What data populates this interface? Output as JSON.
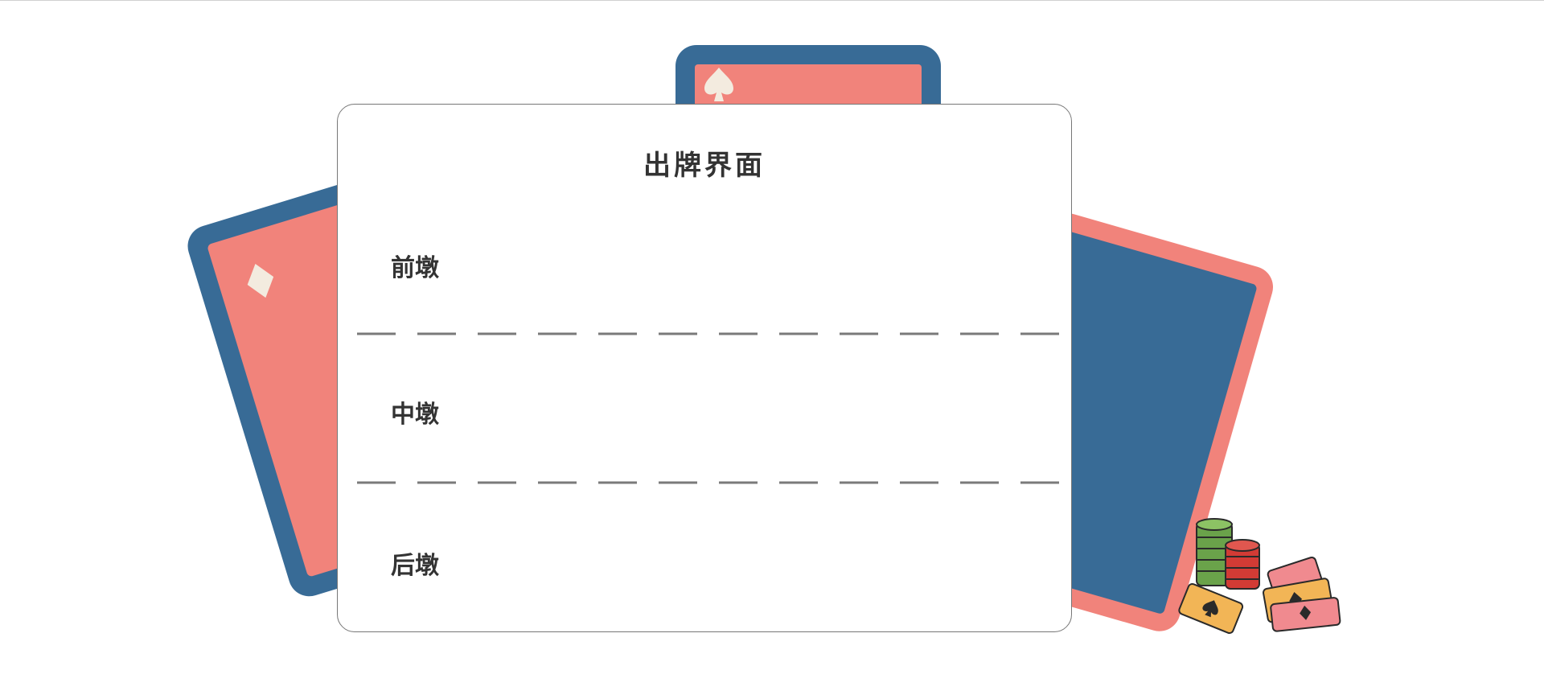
{
  "panel": {
    "title": "出牌界面",
    "rows": [
      {
        "label": "前墩"
      },
      {
        "label": "中墩"
      },
      {
        "label": "后墩"
      }
    ]
  },
  "colors": {
    "card_blue": "#386b96",
    "card_coral": "#f1837b",
    "suit_cream": "#f3ebdf",
    "divider": "#7a7a7a",
    "text": "#333333"
  },
  "decor": {
    "background_cards": [
      "diamond-card",
      "spade-card",
      "heart-card"
    ],
    "illustration": "poker-chips-and-cards"
  }
}
